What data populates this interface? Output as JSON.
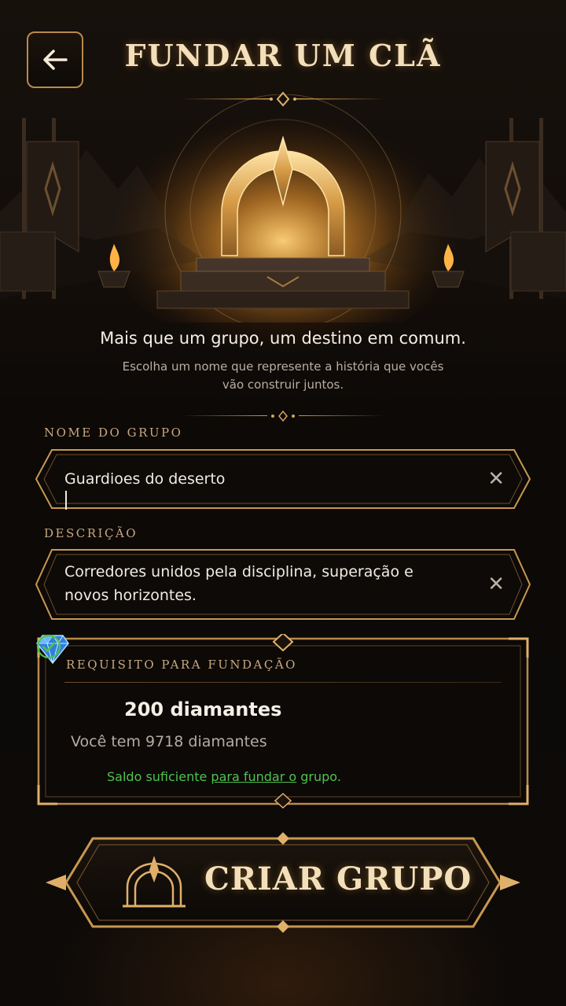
{
  "header": {
    "title": "FUNDAR UM CLÃ",
    "back_icon": "arrow-left-icon"
  },
  "intro": {
    "tagline": "Mais que um grupo, um destino em comum.",
    "subtitle_lines": [
      "Escolha um nome que represente a história que vocês",
      "vão construir juntos."
    ]
  },
  "form": {
    "name_label": "NOME DO GRUPO",
    "name_value": "Guardioes do deserto",
    "description_label": "DESCRIÇÃO",
    "description_lines": [
      "Corredores unidos pela disciplina, superação e",
      "novos horizontes."
    ],
    "clear_icon": "close-icon"
  },
  "requirement": {
    "title": "REQUISITO PARA FUNDAÇÃO",
    "cost": "200 diamantes",
    "balance": "Você tem 9718 diamantes",
    "status_prefix": "Saldo suficiente ",
    "status_link": "para fundar o",
    "status_suffix": " grupo.",
    "status_color": "#4fc24f"
  },
  "actions": {
    "create_label": "CRIAR GRUPO"
  },
  "colors": {
    "accent_gold": "#c9974f",
    "background": "#0b0806"
  }
}
